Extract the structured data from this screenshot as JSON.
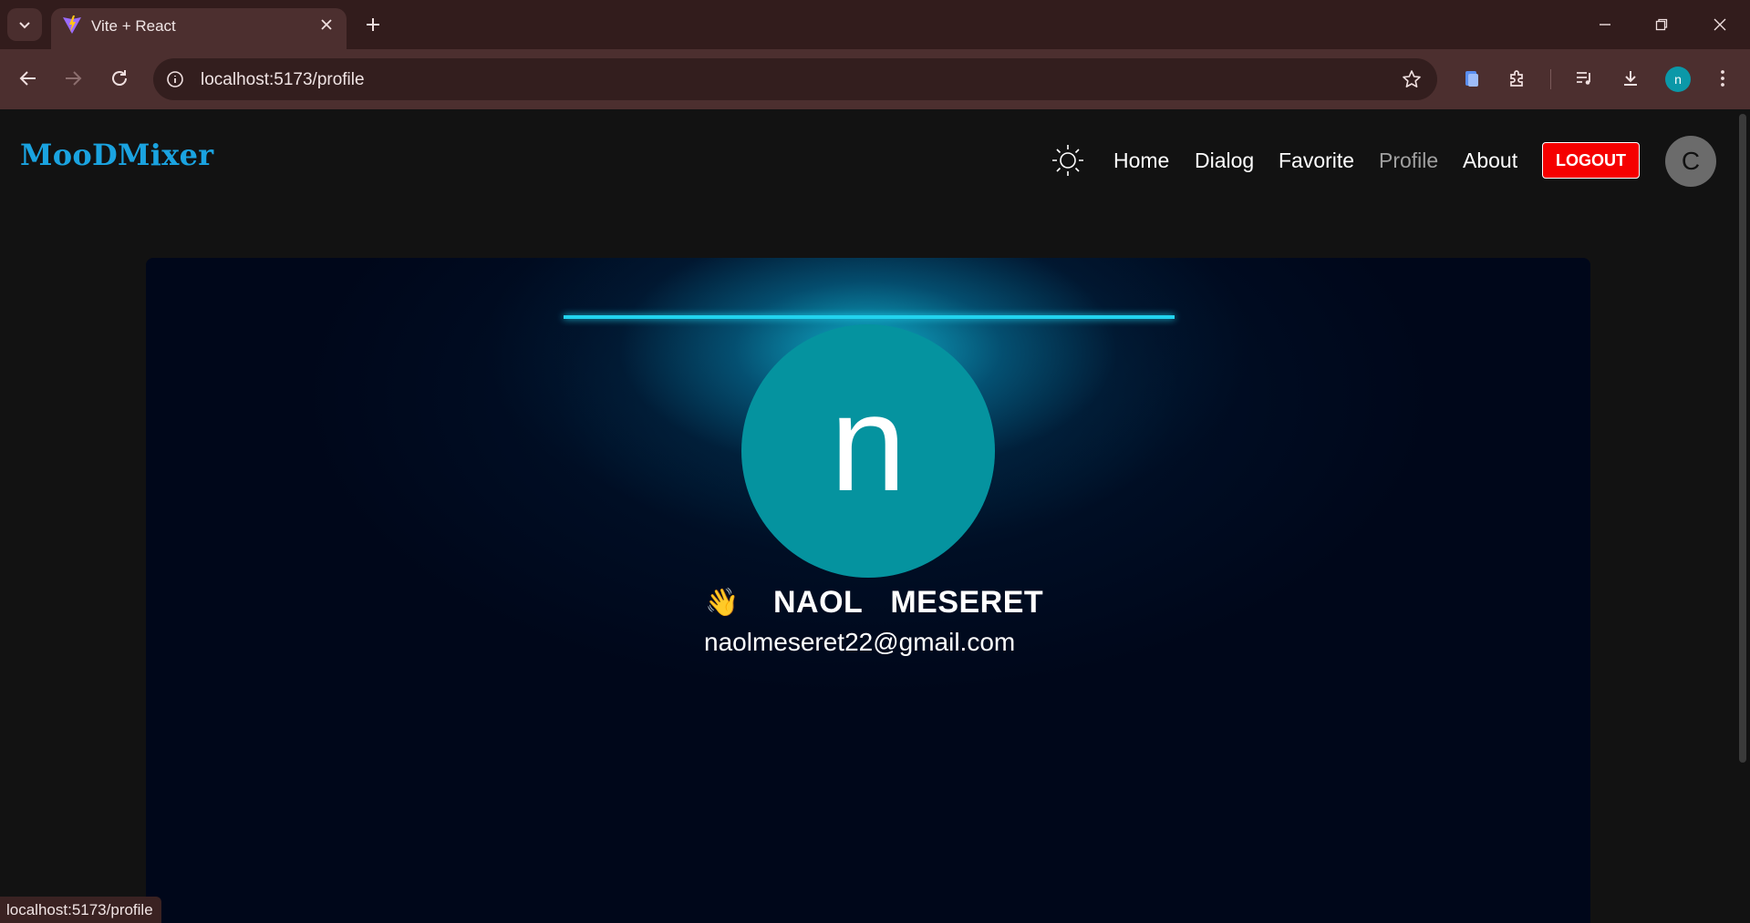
{
  "browser": {
    "tab_title": "Vite + React",
    "url": "localhost:5173/profile",
    "profile_initial": "n",
    "status_url": "localhost:5173/profile"
  },
  "navbar": {
    "logo": "MooDMixer",
    "links": [
      {
        "label": "Home",
        "active": false
      },
      {
        "label": "Dialog",
        "active": false
      },
      {
        "label": "Favorite",
        "active": false
      },
      {
        "label": "Profile",
        "active": true
      },
      {
        "label": "About",
        "active": false
      }
    ],
    "logout_label": "LOGOUT",
    "avatar_initial": "C"
  },
  "profile": {
    "avatar_initial": "n",
    "greeting_emoji": "👋",
    "first_name": "NAOL",
    "last_name": "MESERET",
    "email": "naolmeseret22@gmail.com"
  },
  "colors": {
    "logo": "#1aa3e0",
    "logout_bg": "#f50000",
    "avatar_bg": "#05939f",
    "lamp": "#22d3ee",
    "card_bg": "#00071a"
  }
}
